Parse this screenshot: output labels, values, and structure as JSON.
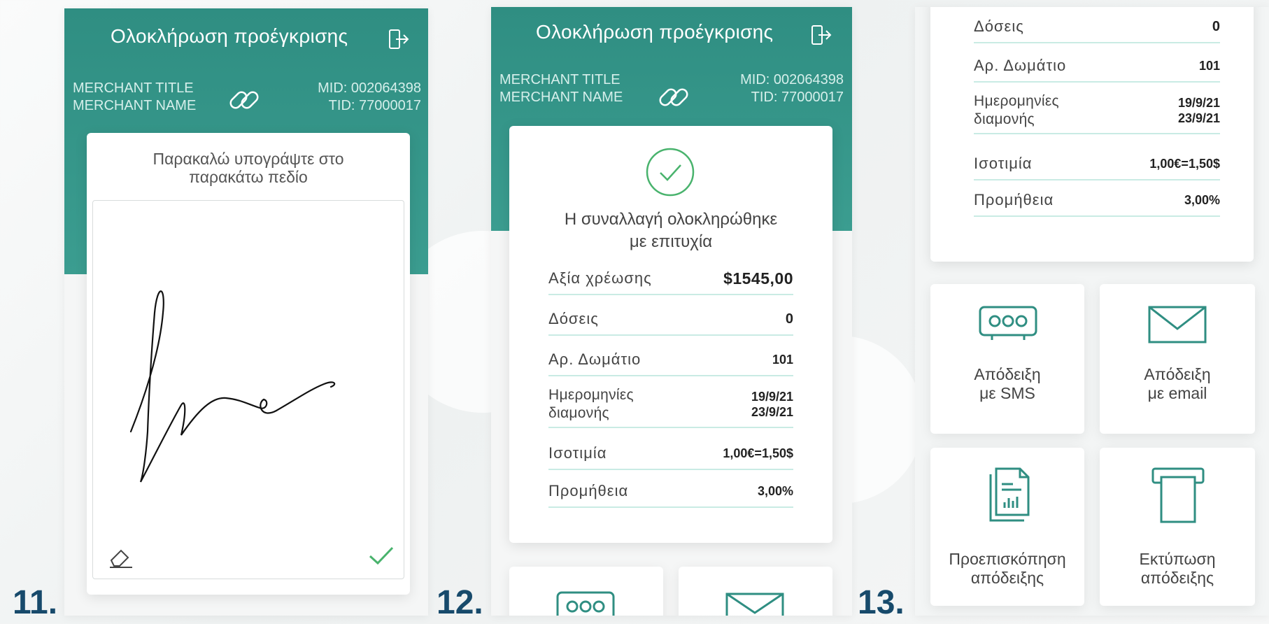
{
  "steps": [
    "11.",
    "12.",
    "13."
  ],
  "header": {
    "title": "Ολοκλήρωση προέγκρισης",
    "merchant_title": "MERCHANT TITLE",
    "merchant_name": "MERCHANT NAME",
    "mid": "MID: 002064398",
    "tid": "TID: 77000017"
  },
  "signature": {
    "prompt_line1": "Παρακαλώ υπογράψτε στο",
    "prompt_line2": "παρακάτω πεδίο"
  },
  "success": {
    "line1": "Η συναλλαγή ολοκληρώθηκε",
    "line2": "με επιτυχία"
  },
  "details": [
    {
      "label": "Αξία χρέωσης",
      "value": "$1545,00"
    },
    {
      "label": "Δόσεις",
      "value": "0"
    },
    {
      "label": "Αρ. Δωμάτιο",
      "value": "101"
    },
    {
      "label": "Ημερομηνίες",
      "label2": "διαμονής",
      "value": "19/9/21",
      "value2": "23/9/21"
    },
    {
      "label": "Ισοτιμία",
      "value": "1,00€=1,50$"
    },
    {
      "label": "Προμήθεια",
      "value": "3,00%"
    }
  ],
  "actions": {
    "sms_line1": "Απόδειξη",
    "sms_line2": "με SMS",
    "email_line1": "Απόδειξη",
    "email_line2": "με email",
    "preview_line1": "Προεπισκόπηση",
    "preview_line2": "απόδειξης",
    "print_line1": "Εκτύπωση",
    "print_line2": "απόδειξης"
  },
  "colors": {
    "header_teal": "#3b9d90",
    "accent_green": "#49b36d",
    "row_divider": "#c9ebe4",
    "step_number": "#174a6b"
  }
}
